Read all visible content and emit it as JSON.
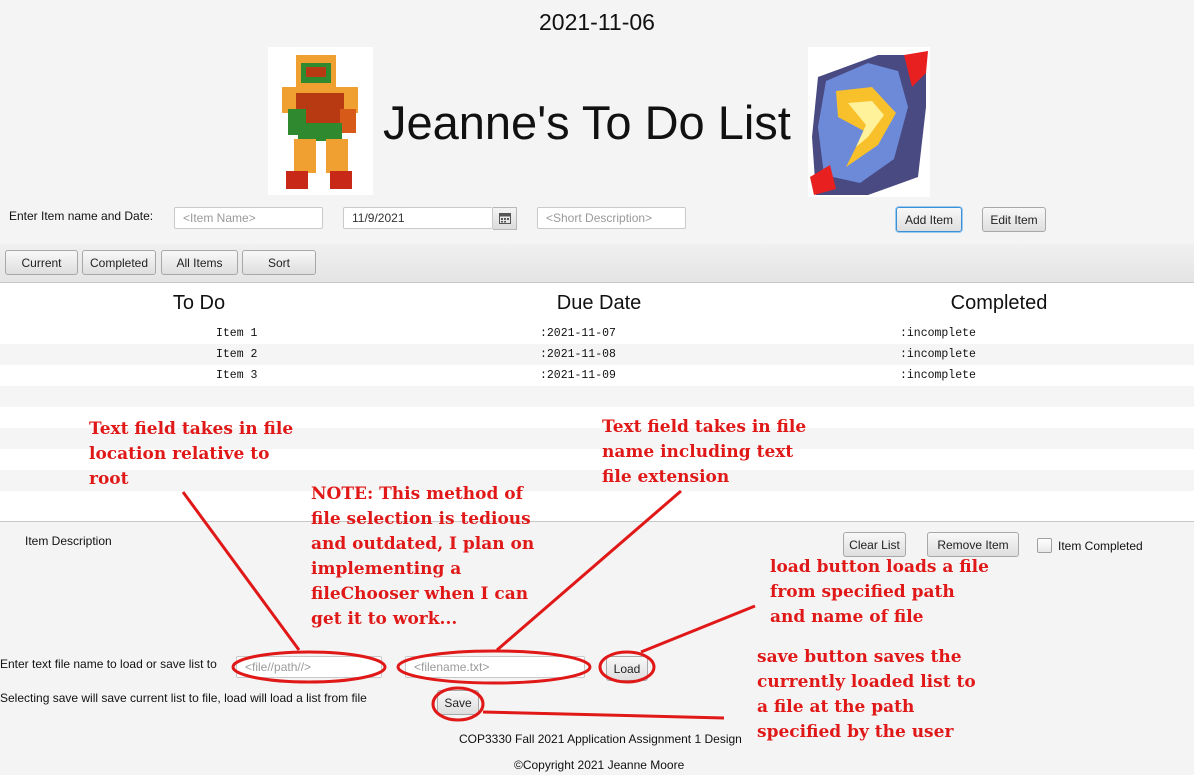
{
  "header": {
    "date": "2021-11-06",
    "title": "Jeanne's To Do List",
    "left_sprite": "samus-icon",
    "right_sprite": "fireball-icon"
  },
  "entry": {
    "label": "Enter Item name and Date:",
    "item_name_placeholder": "<Item Name>",
    "date_value": "11/9/2021",
    "description_placeholder": "<Short Description>",
    "add_label": "Add Item",
    "edit_label": "Edit Item"
  },
  "toolbar": {
    "current": "Current",
    "completed": "Completed",
    "all_items": "All Items",
    "sort": "Sort"
  },
  "list": {
    "columns": [
      "To Do",
      "Due Date",
      "Completed"
    ],
    "rows": [
      {
        "name": "Item 1",
        "due": ":2021-11-07",
        "status": ":incomplete"
      },
      {
        "name": "Item 2",
        "due": ":2021-11-08",
        "status": ":incomplete"
      },
      {
        "name": "Item 3",
        "due": ":2021-11-09",
        "status": ":incomplete"
      }
    ]
  },
  "details": {
    "item_description_label": "Item Description",
    "clear_label": "Clear List",
    "remove_label": "Remove Item",
    "completed_checkbox_label": "Item Completed"
  },
  "file": {
    "prompt": "Enter text file name to load or save list to",
    "hint": "Selecting save will save current list to file, load will load a list from file",
    "path_placeholder": "<file//path//>",
    "filename_placeholder": "<filename.txt>",
    "load_label": "Load",
    "save_label": "Save"
  },
  "footer": {
    "course": "COP3330 Fall 2021 Application Assignment 1 Design",
    "copyright": "©Copyright 2021 Jeanne Moore"
  },
  "annotations": {
    "path_note": [
      "Text field takes in file",
      "location relative to",
      "root"
    ],
    "method_note": [
      "NOTE: This method of",
      "file selection is tedious",
      "and outdated, I plan on",
      "implementing a",
      "fileChooser when I can",
      "get it to work..."
    ],
    "filename_note": [
      "Text field takes in file",
      "name including text",
      "file extension"
    ],
    "load_note": [
      "load button loads a file",
      "from specified path",
      "and name of file"
    ],
    "save_note": [
      "save button saves the",
      "currently loaded list to",
      "a file at the path",
      "specified by the user"
    ]
  },
  "colors": {
    "annotation": "#e01818",
    "focus": "#3a8fd6"
  }
}
